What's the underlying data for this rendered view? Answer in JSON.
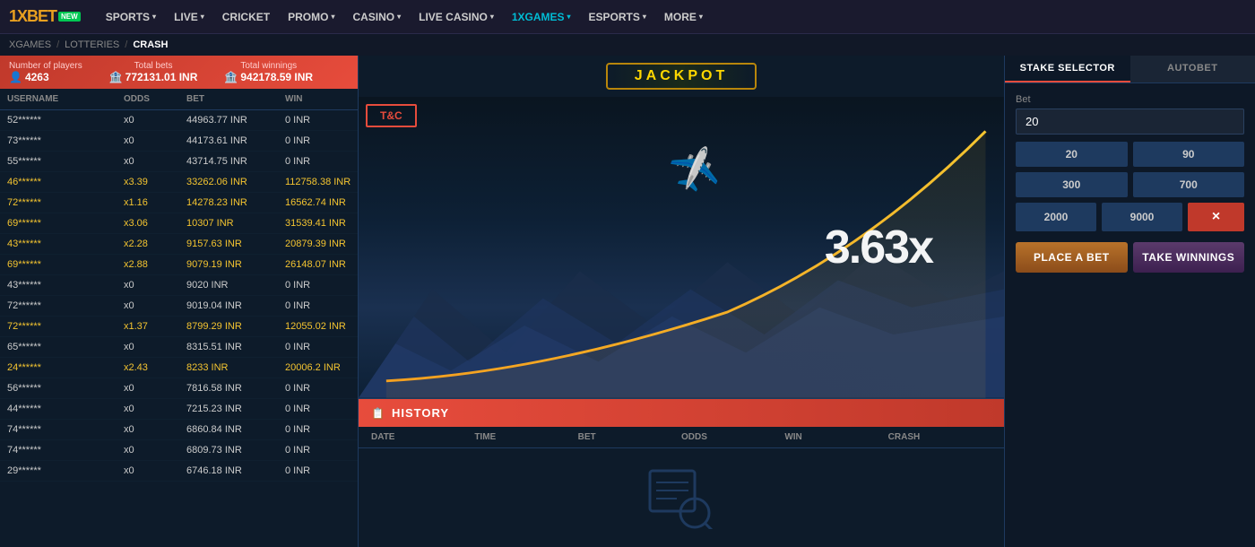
{
  "navbar": {
    "logo": "1XBET",
    "logo_new": "NEW",
    "items": [
      {
        "label": "SPORTS",
        "hasChevron": true,
        "active": false,
        "highlight": false
      },
      {
        "label": "LIVE",
        "hasChevron": true,
        "active": false,
        "highlight": false
      },
      {
        "label": "CRICKET",
        "hasChevron": false,
        "active": false,
        "highlight": false
      },
      {
        "label": "PROMO",
        "hasChevron": true,
        "active": false,
        "highlight": false
      },
      {
        "label": "CASINO",
        "hasChevron": true,
        "active": false,
        "highlight": false
      },
      {
        "label": "LIVE CASINO",
        "hasChevron": true,
        "active": false,
        "highlight": false
      },
      {
        "label": "1XGAMES",
        "hasChevron": true,
        "active": true,
        "highlight": true
      },
      {
        "label": "ESPORTS",
        "hasChevron": true,
        "active": false,
        "highlight": false
      },
      {
        "label": "MORE",
        "hasChevron": true,
        "active": false,
        "highlight": false
      }
    ]
  },
  "breadcrumb": {
    "items": [
      "XGAMES",
      "LOTTERIES",
      "CRASH"
    ]
  },
  "stats": {
    "players_label": "Number of players",
    "players_value": "4263",
    "players_icon": "👤",
    "total_bets_label": "Total bets",
    "total_bets_value": "772131.01 INR",
    "total_bets_icon": "🏦",
    "total_winnings_label": "Total winnings",
    "total_winnings_value": "942178.59 INR",
    "total_winnings_icon": "🏦"
  },
  "table": {
    "headers": [
      "USERNAME",
      "ODDS",
      "BET",
      "WIN"
    ],
    "rows": [
      {
        "username": "52******",
        "odds": "x0",
        "bet": "44963.77 INR",
        "win": "0 INR",
        "win_positive": false
      },
      {
        "username": "73******",
        "odds": "x0",
        "bet": "44173.61 INR",
        "win": "0 INR",
        "win_positive": false
      },
      {
        "username": "55******",
        "odds": "x0",
        "bet": "43714.75 INR",
        "win": "0 INR",
        "win_positive": false
      },
      {
        "username": "46******",
        "odds": "x3.39",
        "bet": "33262.06 INR",
        "win": "112758.38 INR",
        "win_positive": true
      },
      {
        "username": "72******",
        "odds": "x1.16",
        "bet": "14278.23 INR",
        "win": "16562.74 INR",
        "win_positive": true
      },
      {
        "username": "69******",
        "odds": "x3.06",
        "bet": "10307 INR",
        "win": "31539.41 INR",
        "win_positive": true
      },
      {
        "username": "43******",
        "odds": "x2.28",
        "bet": "9157.63 INR",
        "win": "20879.39 INR",
        "win_positive": true
      },
      {
        "username": "69******",
        "odds": "x2.88",
        "bet": "9079.19 INR",
        "win": "26148.07 INR",
        "win_positive": true
      },
      {
        "username": "43******",
        "odds": "x0",
        "bet": "9020 INR",
        "win": "0 INR",
        "win_positive": false
      },
      {
        "username": "72******",
        "odds": "x0",
        "bet": "9019.04 INR",
        "win": "0 INR",
        "win_positive": false
      },
      {
        "username": "72******",
        "odds": "x1.37",
        "bet": "8799.29 INR",
        "win": "12055.02 INR",
        "win_positive": true
      },
      {
        "username": "65******",
        "odds": "x0",
        "bet": "8315.51 INR",
        "win": "0 INR",
        "win_positive": false
      },
      {
        "username": "24******",
        "odds": "x2.43",
        "bet": "8233 INR",
        "win": "20006.2 INR",
        "win_positive": true
      },
      {
        "username": "56******",
        "odds": "x0",
        "bet": "7816.58 INR",
        "win": "0 INR",
        "win_positive": false
      },
      {
        "username": "44******",
        "odds": "x0",
        "bet": "7215.23 INR",
        "win": "0 INR",
        "win_positive": false
      },
      {
        "username": "74******",
        "odds": "x0",
        "bet": "6860.84 INR",
        "win": "0 INR",
        "win_positive": false
      },
      {
        "username": "74******",
        "odds": "x0",
        "bet": "6809.73 INR",
        "win": "0 INR",
        "win_positive": false
      },
      {
        "username": "29******",
        "odds": "x0",
        "bet": "6746.18 INR",
        "win": "0 INR",
        "win_positive": false
      }
    ]
  },
  "jackpot": {
    "label": "JACKPOT"
  },
  "game": {
    "multiplier": "3.63x",
    "tc_label": "T&C"
  },
  "history": {
    "title": "HISTORY",
    "icon": "📋",
    "columns": [
      "DATE",
      "TIME",
      "BET",
      "ODDS",
      "WIN",
      "CRASH"
    ],
    "empty": true
  },
  "stake_selector": {
    "active_tab": "STAKE SELECTOR",
    "inactive_tab": "AUTOBET",
    "bet_label": "Bet",
    "bet_value": "20",
    "quick_bets_row1": [
      "20",
      "90",
      "300",
      "700"
    ],
    "quick_bets_row2": [
      "2000",
      "9000",
      "×"
    ],
    "place_btn": "PLACE A BET",
    "take_btn": "TAKE WINNINGS"
  }
}
